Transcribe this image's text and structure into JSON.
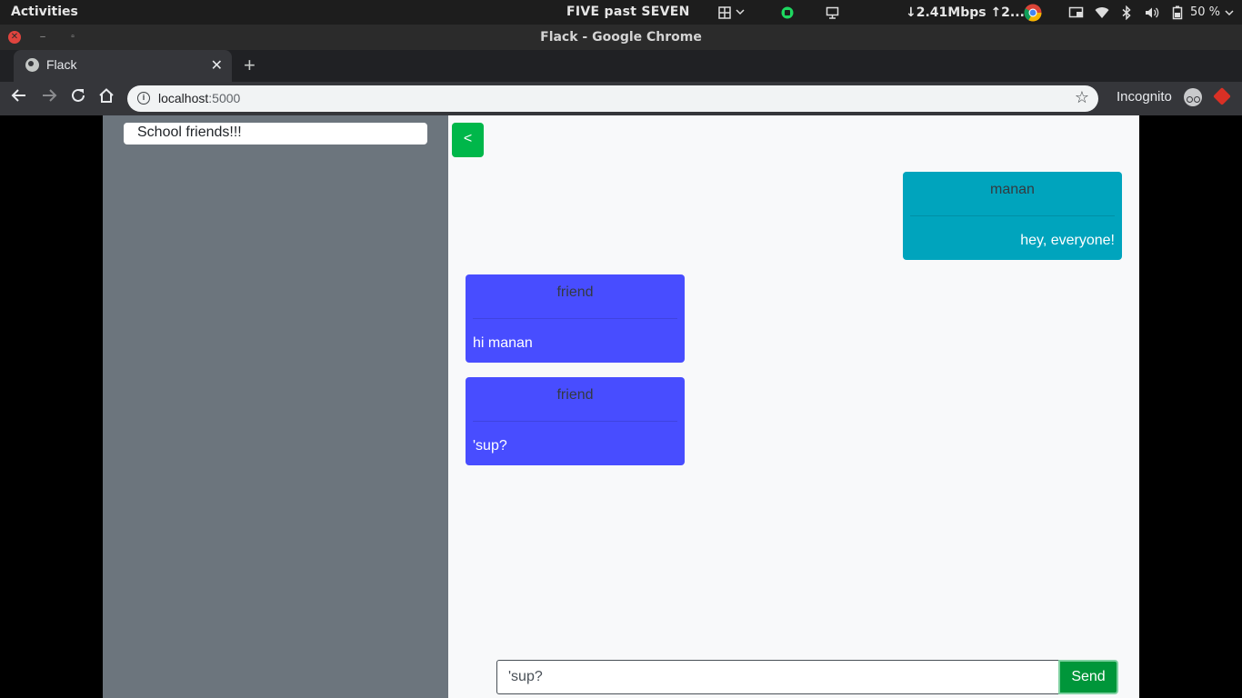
{
  "system_bar": {
    "activities": "Activities",
    "clock": "FIVE past SEVEN",
    "network_speed": "↓2.41Mbps ↑2...",
    "battery": "50 %"
  },
  "window": {
    "title": "Flack - Google Chrome"
  },
  "browser": {
    "tab_title": "Flack",
    "tab_close": "✕",
    "new_tab": "+",
    "url_host": "localhost",
    "url_port": ":5000",
    "profile_label": "Incognito"
  },
  "sidebar": {
    "channels": [
      "School friends!!!"
    ]
  },
  "chat": {
    "back_label": "<",
    "messages": [
      {
        "author": "manan",
        "text": "hey, everyone!",
        "side": "right"
      },
      {
        "author": "friend",
        "text": "hi manan",
        "side": "left"
      },
      {
        "author": "friend",
        "text": "'sup?",
        "side": "left"
      }
    ],
    "input_value": "'sup?",
    "send_label": "Send"
  },
  "colors": {
    "own_message": "#00a4bd",
    "other_message": "#484dff",
    "sidebar": "#6c757d",
    "send_button": "#00963a",
    "back_button": "#00b74a"
  },
  "icons": [
    "apps-icon",
    "spotify-icon",
    "display-icon",
    "chrome-icon",
    "cast-icon",
    "wifi-icon",
    "bluetooth-icon",
    "volume-icon",
    "battery-icon",
    "globe-icon",
    "info-icon",
    "star-icon",
    "incognito-icon",
    "extension-icon"
  ]
}
